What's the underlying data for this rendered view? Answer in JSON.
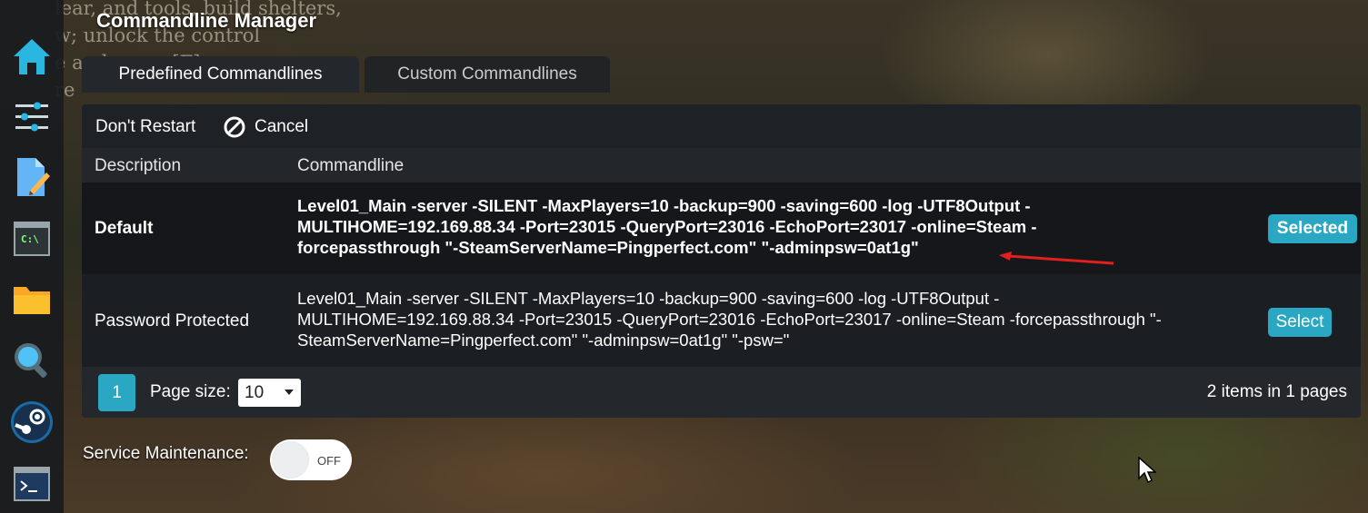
{
  "app": {
    "title": "Commandline Manager"
  },
  "background_text": [
    "lear, and tools, build shelters,",
    "w; unlock the control",
    "e and press [F]",
    "re"
  ],
  "sidebar": {
    "items": [
      {
        "icon": "home-icon"
      },
      {
        "icon": "sliders-icon"
      },
      {
        "icon": "edit-document-icon"
      },
      {
        "icon": "console-icon",
        "text": "C:\\"
      },
      {
        "icon": "folder-icon"
      },
      {
        "icon": "search-icon"
      },
      {
        "icon": "steam-icon"
      },
      {
        "icon": "terminal-icon"
      }
    ]
  },
  "tabs": [
    {
      "label": "Predefined Commandlines",
      "active": true
    },
    {
      "label": "Custom Commandlines",
      "active": false
    }
  ],
  "toolbar": {
    "dont_restart_label": "Don't Restart",
    "cancel_label": "Cancel"
  },
  "grid": {
    "columns": [
      "Description",
      "Commandline"
    ],
    "rows": [
      {
        "description": "Default",
        "commandline": "Level01_Main -server -SILENT -MaxPlayers=10 -backup=900 -saving=600 -log -UTF8Output -MULTIHOME=192.169.88.34 -Port=23015 -QueryPort=23016 -EchoPort=23017 -online=Steam -forcepassthrough \"-SteamServerName=Pingperfect.com\" \"-adminpsw=0at1g\"",
        "action": "Selected"
      },
      {
        "description": "Password Protected",
        "commandline": "Level01_Main -server -SILENT -MaxPlayers=10 -backup=900 -saving=600 -log -UTF8Output -MULTIHOME=192.169.88.34 -Port=23015 -QueryPort=23016 -EchoPort=23017 -online=Steam -forcepassthrough \"-SteamServerName=Pingperfect.com\" \"-adminpsw=0at1g\" \"-psw=\"",
        "action": "Select"
      }
    ]
  },
  "pager": {
    "current_page": "1",
    "page_size_label": "Page size:",
    "page_size_value": "10",
    "info": "2 items in 1 pages"
  },
  "maintenance": {
    "label": "Service Maintenance:",
    "toggle_state": "OFF"
  },
  "colors": {
    "accent": "#2aa7c3",
    "panel": "#1e2125",
    "annotation_arrow": "#e0201c"
  }
}
